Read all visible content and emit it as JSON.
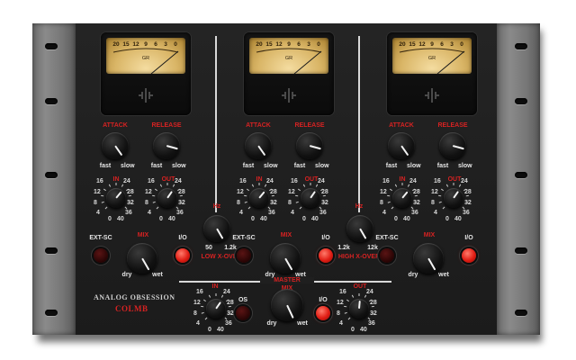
{
  "meter": {
    "scale": [
      "20",
      "15",
      "12",
      "9",
      "6",
      "3",
      "0"
    ],
    "label": "GR"
  },
  "bands": [
    {
      "attack_label": "ATTACK",
      "release_label": "RELEASE",
      "fast": "fast",
      "slow": "slow",
      "in_label": "IN",
      "out_label": "OUT",
      "ext_sc_label": "EXT-SC",
      "mix_label": "MIX",
      "io_label": "I/O",
      "dry": "dry",
      "wet": "wet"
    },
    {
      "attack_label": "ATTACK",
      "release_label": "RELEASE",
      "fast": "fast",
      "slow": "slow",
      "in_label": "IN",
      "out_label": "OUT",
      "ext_sc_label": "EXT-SC",
      "mix_label": "MIX",
      "io_label": "I/O",
      "dry": "dry",
      "wet": "wet"
    },
    {
      "attack_label": "ATTACK",
      "release_label": "RELEASE",
      "fast": "fast",
      "slow": "slow",
      "in_label": "IN",
      "out_label": "OUT",
      "ext_sc_label": "EXT-SC",
      "mix_label": "MIX",
      "io_label": "I/O",
      "dry": "dry",
      "wet": "wet"
    }
  ],
  "gain_scale": {
    "left": [
      "16",
      "12",
      "8",
      "4",
      "0"
    ],
    "right": [
      "24",
      "28",
      "32",
      "36",
      "40"
    ]
  },
  "low_crossover": {
    "knob_label": "Hz",
    "min": "50",
    "max": "1.2k",
    "title": "LOW X-OVER"
  },
  "high_crossover": {
    "knob_label": "Hz",
    "min": "1.2k",
    "max": "12k",
    "title": "HIGH X-OVER"
  },
  "master": {
    "title": "MASTER",
    "mix_label": "MIX",
    "in_label": "IN",
    "out_label": "OUT",
    "os_label": "OS",
    "io_label": "I/O",
    "dry": "dry",
    "wet": "wet"
  },
  "brand": {
    "name": "ANALOG OBSESSION",
    "model": "COLMB"
  },
  "colors": {
    "accent_red": "#d62222",
    "meter_amber": "#e2c07a",
    "panel": "#1e1e1e"
  },
  "controls": {
    "band_attack_deg": [
      -35,
      -35,
      -35
    ],
    "band_release_deg": [
      -75,
      -75,
      -75
    ],
    "band_in_deg": [
      -140,
      -140,
      -140
    ],
    "band_out_deg": [
      -145,
      -145,
      -145
    ],
    "band_mix_deg": [
      -30,
      -30,
      -30
    ],
    "low_xover_deg": [
      -30
    ],
    "high_xover_deg": [
      -30
    ],
    "master_in_deg": [
      -145
    ],
    "master_out_deg": [
      -175
    ],
    "master_mix_deg": [
      -25
    ],
    "band_io_on": [
      true,
      true,
      true
    ],
    "band_ext_sc_on": [
      false,
      false,
      false
    ],
    "master_os_on": false,
    "master_io_on": true
  }
}
